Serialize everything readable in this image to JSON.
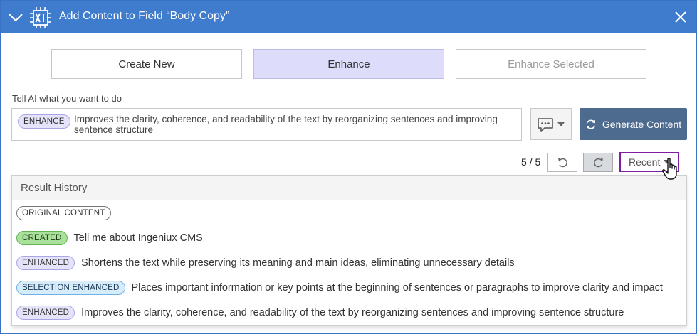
{
  "dialog": {
    "title": "Add Content to Field “Body Copy”",
    "icons": {
      "collapse": "chevron-down-icon",
      "logo": "ai-chip-icon",
      "close": "close-icon"
    },
    "accent_color": "#3f7ccd"
  },
  "tabs": [
    {
      "label": "Create New",
      "state": "default"
    },
    {
      "label": "Enhance",
      "state": "active"
    },
    {
      "label": "Enhance Selected",
      "state": "disabled"
    }
  ],
  "prompt": {
    "label": "Tell AI what you want to do",
    "badge": "ENHANCE",
    "text": "Improves the clarity, coherence, and readability of the text by reorganizing sentences and improving sentence structure"
  },
  "prompt_selector": {
    "icon": "chat-bubble-icon"
  },
  "generate_button": {
    "label": "Generate Content",
    "icon": "refresh-icon",
    "color": "#4d6a8f"
  },
  "navigation": {
    "counter": "5 / 5",
    "undo_icon": "undo-icon",
    "redo_icon": "redo-icon",
    "recent_label": "Recent"
  },
  "history": {
    "header": "Result History",
    "items": [
      {
        "badge": "ORIGINAL CONTENT",
        "type": "original",
        "text": ""
      },
      {
        "badge": "CREATED",
        "type": "created",
        "text": "Tell me about Ingeniux CMS"
      },
      {
        "badge": "ENHANCED",
        "type": "enhance",
        "text": "Shortens the text while preserving its meaning and main ideas, eliminating unnecessary details"
      },
      {
        "badge": "SELECTION ENHANCED",
        "type": "selection",
        "text": "Places important information or key points at the beginning of sentences or paragraphs to improve clarity and impact"
      },
      {
        "badge": "ENHANCED",
        "type": "enhance",
        "text": "Improves the clarity, coherence, and readability of the text by reorganizing sentences and improving sentence structure"
      }
    ]
  }
}
